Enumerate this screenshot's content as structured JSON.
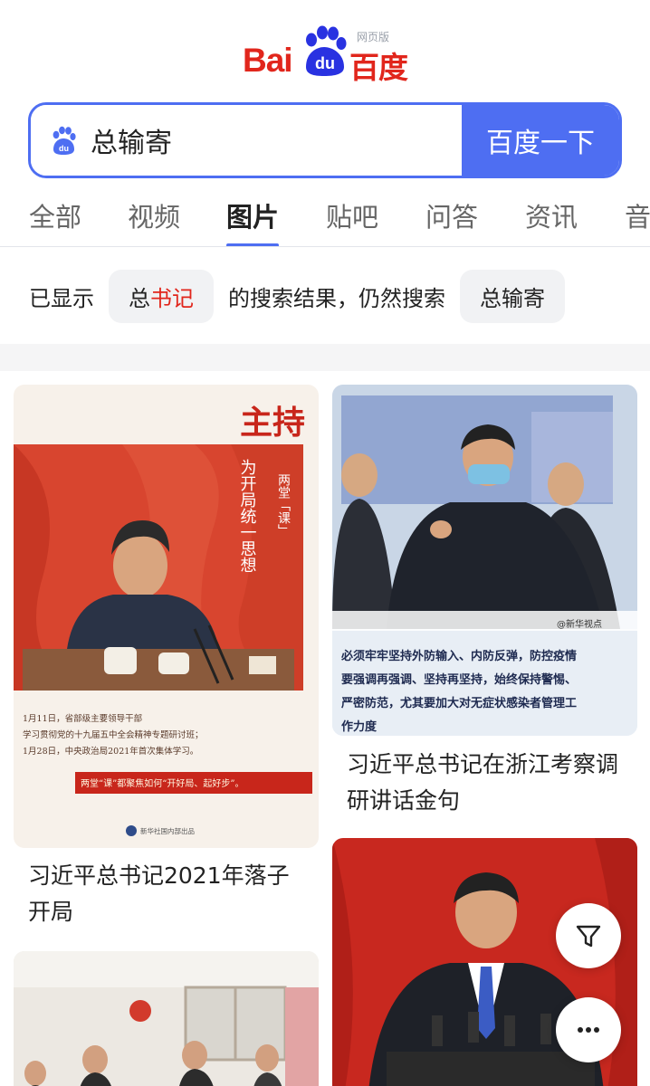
{
  "header": {
    "logo_bai": "Bai",
    "logo_du": "du",
    "logo_cn": "百度",
    "logo_web": "网页版"
  },
  "search": {
    "query": "总输寄",
    "button_label": "百度一下"
  },
  "tabs": [
    {
      "label": "全部"
    },
    {
      "label": "视频"
    },
    {
      "label": "图片",
      "active": true
    },
    {
      "label": "贴吧"
    },
    {
      "label": "问答"
    },
    {
      "label": "资讯"
    },
    {
      "label": "音"
    }
  ],
  "notice": {
    "prefix": "已显示",
    "corrected_part1": "总",
    "corrected_part2": "书记",
    "middle": "的搜索结果，仍然搜索",
    "original": "总输寄"
  },
  "results": [
    {
      "caption_line1": "习近平总书记2021年落子",
      "caption_line2": "开局",
      "img_text": {
        "title_big": "主持",
        "subtitle": "两堂「课」",
        "vertical": "为开局统一思想",
        "desc1": "1月11日，省部级主要领导干部",
        "desc2": "学习贯彻党的十九届五中全会精神专题研讨班；",
        "desc3": "1月28日，中央政治局2021年首次集体学习。",
        "banner": "两堂“课”都聚焦如何“开好局、起好步”。",
        "source": "新华社国内部出品"
      }
    },
    {
      "caption_line1": "习近平总书记在浙江考察调",
      "caption_line2": "研讲话金句",
      "img_text": {
        "watermark": "@新华视点",
        "quote1": "必须牢牢坚持外防输入、内防反弹，防控疫情",
        "quote2": "要强调再强调、坚持再坚持，始终保持警惕、",
        "quote3": "严密防范，尤其要加大对无症状感染者管理工",
        "quote4": "作力度"
      }
    },
    {
      "caption_line1": "",
      "caption_line2": ""
    },
    {
      "caption_line1": "",
      "caption_line2": ""
    }
  ],
  "colors": {
    "accent": "#4e6ef2",
    "brand_red": "#e1261c"
  },
  "icons": {
    "filter": "filter-icon",
    "more": "more-icon",
    "search": "paw-icon"
  }
}
